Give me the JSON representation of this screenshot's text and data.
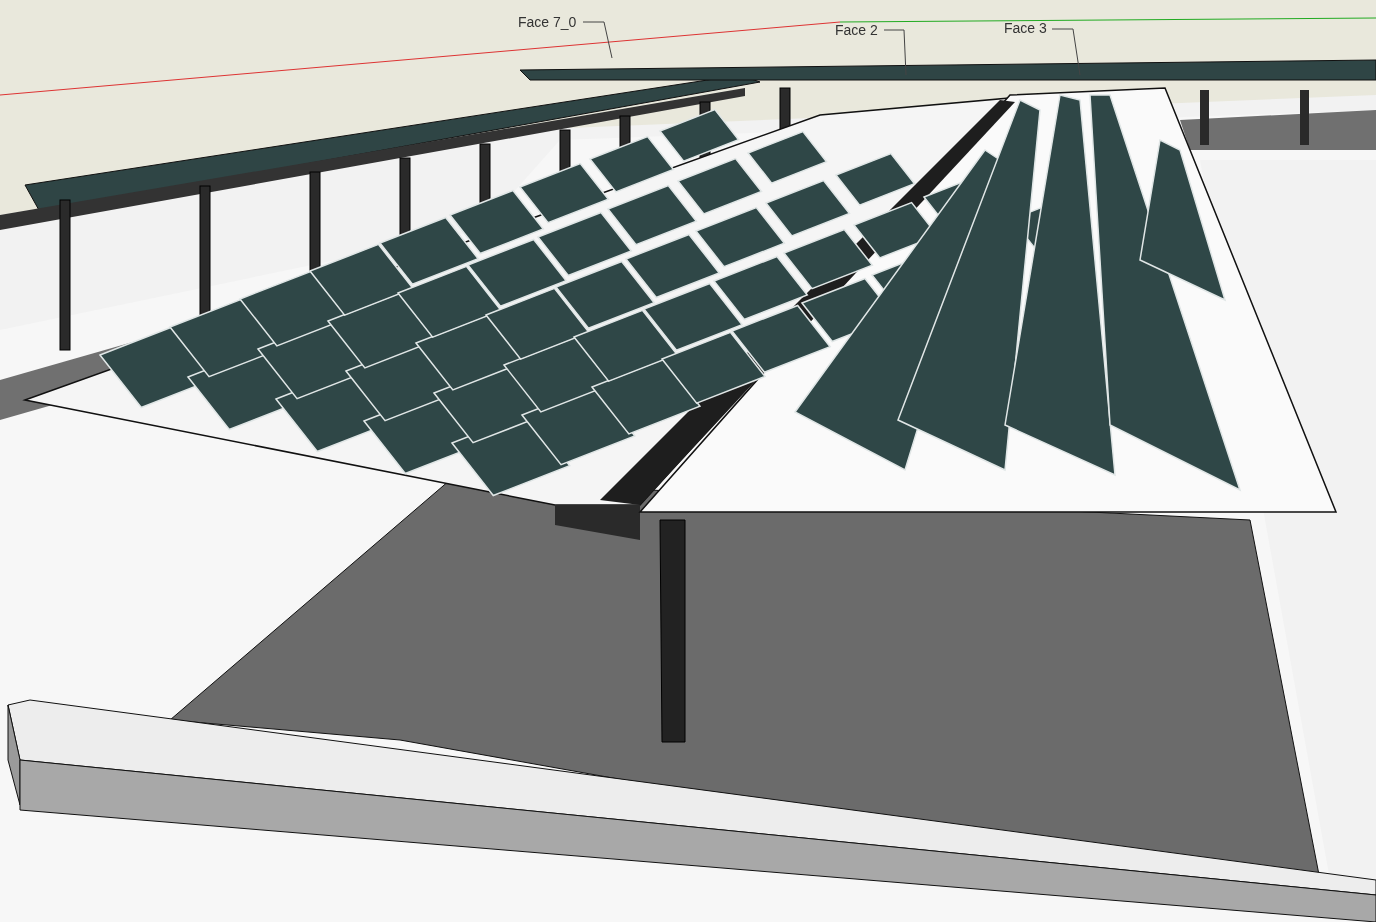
{
  "viewport": {
    "labels": [
      {
        "text": "Face 7_0"
      },
      {
        "text": "Face 2"
      },
      {
        "text": "Face 3"
      }
    ]
  }
}
